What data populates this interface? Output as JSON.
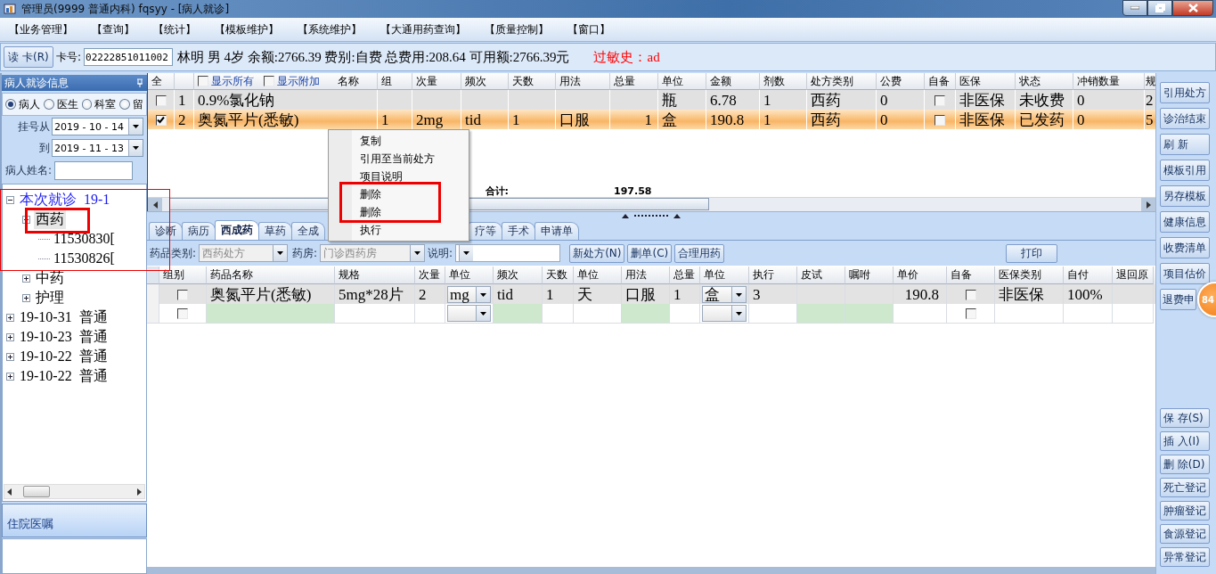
{
  "window": {
    "title": "管理员(9999 普通内科) fqsyy - [病人就诊]"
  },
  "menu": [
    "【业务管理】",
    "【查询】",
    "【统计】",
    "【模板维护】",
    "【系统维护】",
    "【大通用药查询】",
    "【质量控制】",
    "【窗口】"
  ],
  "patient_bar": {
    "read_card_button": "读 卡(R)",
    "card_label": "卡号:",
    "card_number": "02222851011002",
    "summary": "林明 男 4岁 余额:2766.39 费别:自费 总费用:208.64 可用额:2766.39元",
    "allergy": "过敏史：ad"
  },
  "left_panel": {
    "title": "病人就诊信息",
    "scope_options": [
      {
        "label": "病人",
        "selected": true
      },
      {
        "label": "医生",
        "selected": false
      },
      {
        "label": "科室",
        "selected": false
      },
      {
        "label": "留",
        "selected": false
      }
    ],
    "date_from": {
      "label": "挂号从",
      "value": "2019 - 10 - 14"
    },
    "date_to": {
      "label": "到",
      "value": "2019 - 11 - 13"
    },
    "name_label": "病人姓名:",
    "tree": [
      {
        "label": "本次就诊  19-1",
        "current": true,
        "expanded": true,
        "selected": false,
        "children": [
          {
            "label": "西药",
            "expanded": true,
            "selected": true,
            "children": [
              {
                "label": "11530830[",
                "selected": false
              },
              {
                "label": "11530826[",
                "selected": false
              }
            ]
          },
          {
            "label": "中药",
            "expanded": false,
            "selected": false
          },
          {
            "label": "护理",
            "expanded": false,
            "selected": false
          }
        ]
      },
      {
        "label": "19-10-31  普通",
        "current": false,
        "expanded": false,
        "selected": false
      },
      {
        "label": "19-10-23  普通",
        "current": false,
        "expanded": false,
        "selected": false
      },
      {
        "label": "19-10-22  普通",
        "current": false,
        "expanded": false,
        "selected": false
      },
      {
        "label": "19-10-22  普通",
        "current": false,
        "expanded": false,
        "selected": false
      }
    ],
    "footer_title": "住院医嘱"
  },
  "orders": {
    "show_all": {
      "label": "显示所有",
      "checked": false
    },
    "show_extra": {
      "label": "显示附加",
      "checked": false
    },
    "headers": {
      "all": "全",
      "name": "名称",
      "group": "组",
      "dose": "次量",
      "freq": "频次",
      "days": "天数",
      "usage": "用法",
      "total": "总量",
      "unit": "单位",
      "amount": "金额",
      "doses": "剂数",
      "rx_type": "处方类别",
      "public_fee": "公费",
      "self_supplied": "自备",
      "insurance": "医保",
      "status": "状态",
      "writeoff_qty": "冲销数量",
      "column_19": "规"
    },
    "rows": [
      {
        "checked": false,
        "selected": false,
        "no": "1",
        "name": "0.9%氯化钠",
        "unit": "瓶",
        "amount": "6.78",
        "doses": "1",
        "rx_type": "西药",
        "public_fee": "0",
        "self_supplied": false,
        "insurance": "非医保",
        "status": "未收费",
        "writeoff_qty": "0",
        "column_19": "2"
      },
      {
        "checked": true,
        "selected": true,
        "no": "2",
        "name": "奥氮平片(悉敏)",
        "group": "1",
        "dose": "2mg",
        "freq": "tid",
        "days": "1",
        "usage": "口服",
        "total": "1",
        "unit": "盒",
        "amount": "190.8",
        "doses": "1",
        "rx_type": "西药",
        "public_fee": "0",
        "self_supplied": false,
        "insurance": "非医保",
        "status": "已发药",
        "writeoff_qty": "0",
        "column_19": "5"
      }
    ],
    "totals": {
      "label": "合计:",
      "amount": "197.58"
    }
  },
  "tabs": [
    {
      "label": "诊断",
      "selected": false
    },
    {
      "label": "病历",
      "selected": false
    },
    {
      "label": "西成药",
      "selected": true
    },
    {
      "label": "草药",
      "selected": false
    },
    {
      "label": "全成",
      "selected": false
    },
    {
      "label": "疗等",
      "selected": false
    },
    {
      "label": "手术",
      "selected": false
    },
    {
      "label": "申请单",
      "selected": false
    }
  ],
  "toolbar": {
    "category_label": "药品类别:",
    "category_value": "西药处方",
    "pharmacy_label": "药房:",
    "pharmacy_value": "门诊西药房",
    "note_label": "说明:",
    "buttons": [
      "新处方(N)",
      "删单(C)",
      "合理用药"
    ],
    "print_button": "打印"
  },
  "details": {
    "headers": {
      "group": "组别",
      "name": "药品名称",
      "spec": "规格",
      "dose": "次量",
      "dose_unit": "单位",
      "freq": "频次",
      "days": "天数",
      "days_unit": "单位",
      "usage": "用法",
      "total": "总量",
      "total_unit": "单位",
      "exec": "执行",
      "skin_test": "皮试",
      "instruction": "嘱咐",
      "price": "单价",
      "self_supplied": "自备",
      "insurance_type": "医保类别",
      "self_pay": "自付",
      "column_20": "退回原"
    },
    "rows": [
      {
        "selected": true,
        "grouped": false,
        "name": "奥氮平片(悉敏)",
        "spec": "5mg*28片",
        "dose": "2",
        "dose_unit": "mg",
        "freq": "tid",
        "days": "1",
        "days_unit": "天",
        "usage": "口服",
        "total": "1",
        "total_unit": "盒",
        "exec": "3",
        "price": "190.8",
        "self_supplied": false,
        "insurance_type": "非医保",
        "self_pay": "100%"
      },
      {
        "selected": false,
        "grouped": false,
        "self_supplied": false
      }
    ]
  },
  "actions": {
    "top": [
      "引用处方",
      "诊治结束",
      "刷 新",
      "模板引用",
      "另存模板",
      "健康信息",
      "收费清单",
      "项目估价",
      "退费申"
    ],
    "bottom": [
      "保 存(S)",
      "插 入(I)",
      "删 除(D)",
      "死亡登记",
      "肿瘤登记",
      "食源登记",
      "异常登记"
    ]
  },
  "badge": "84",
  "context_menu": [
    "复制",
    "引用至当前处方",
    "项目说明",
    "删除",
    "删除",
    "执行"
  ]
}
